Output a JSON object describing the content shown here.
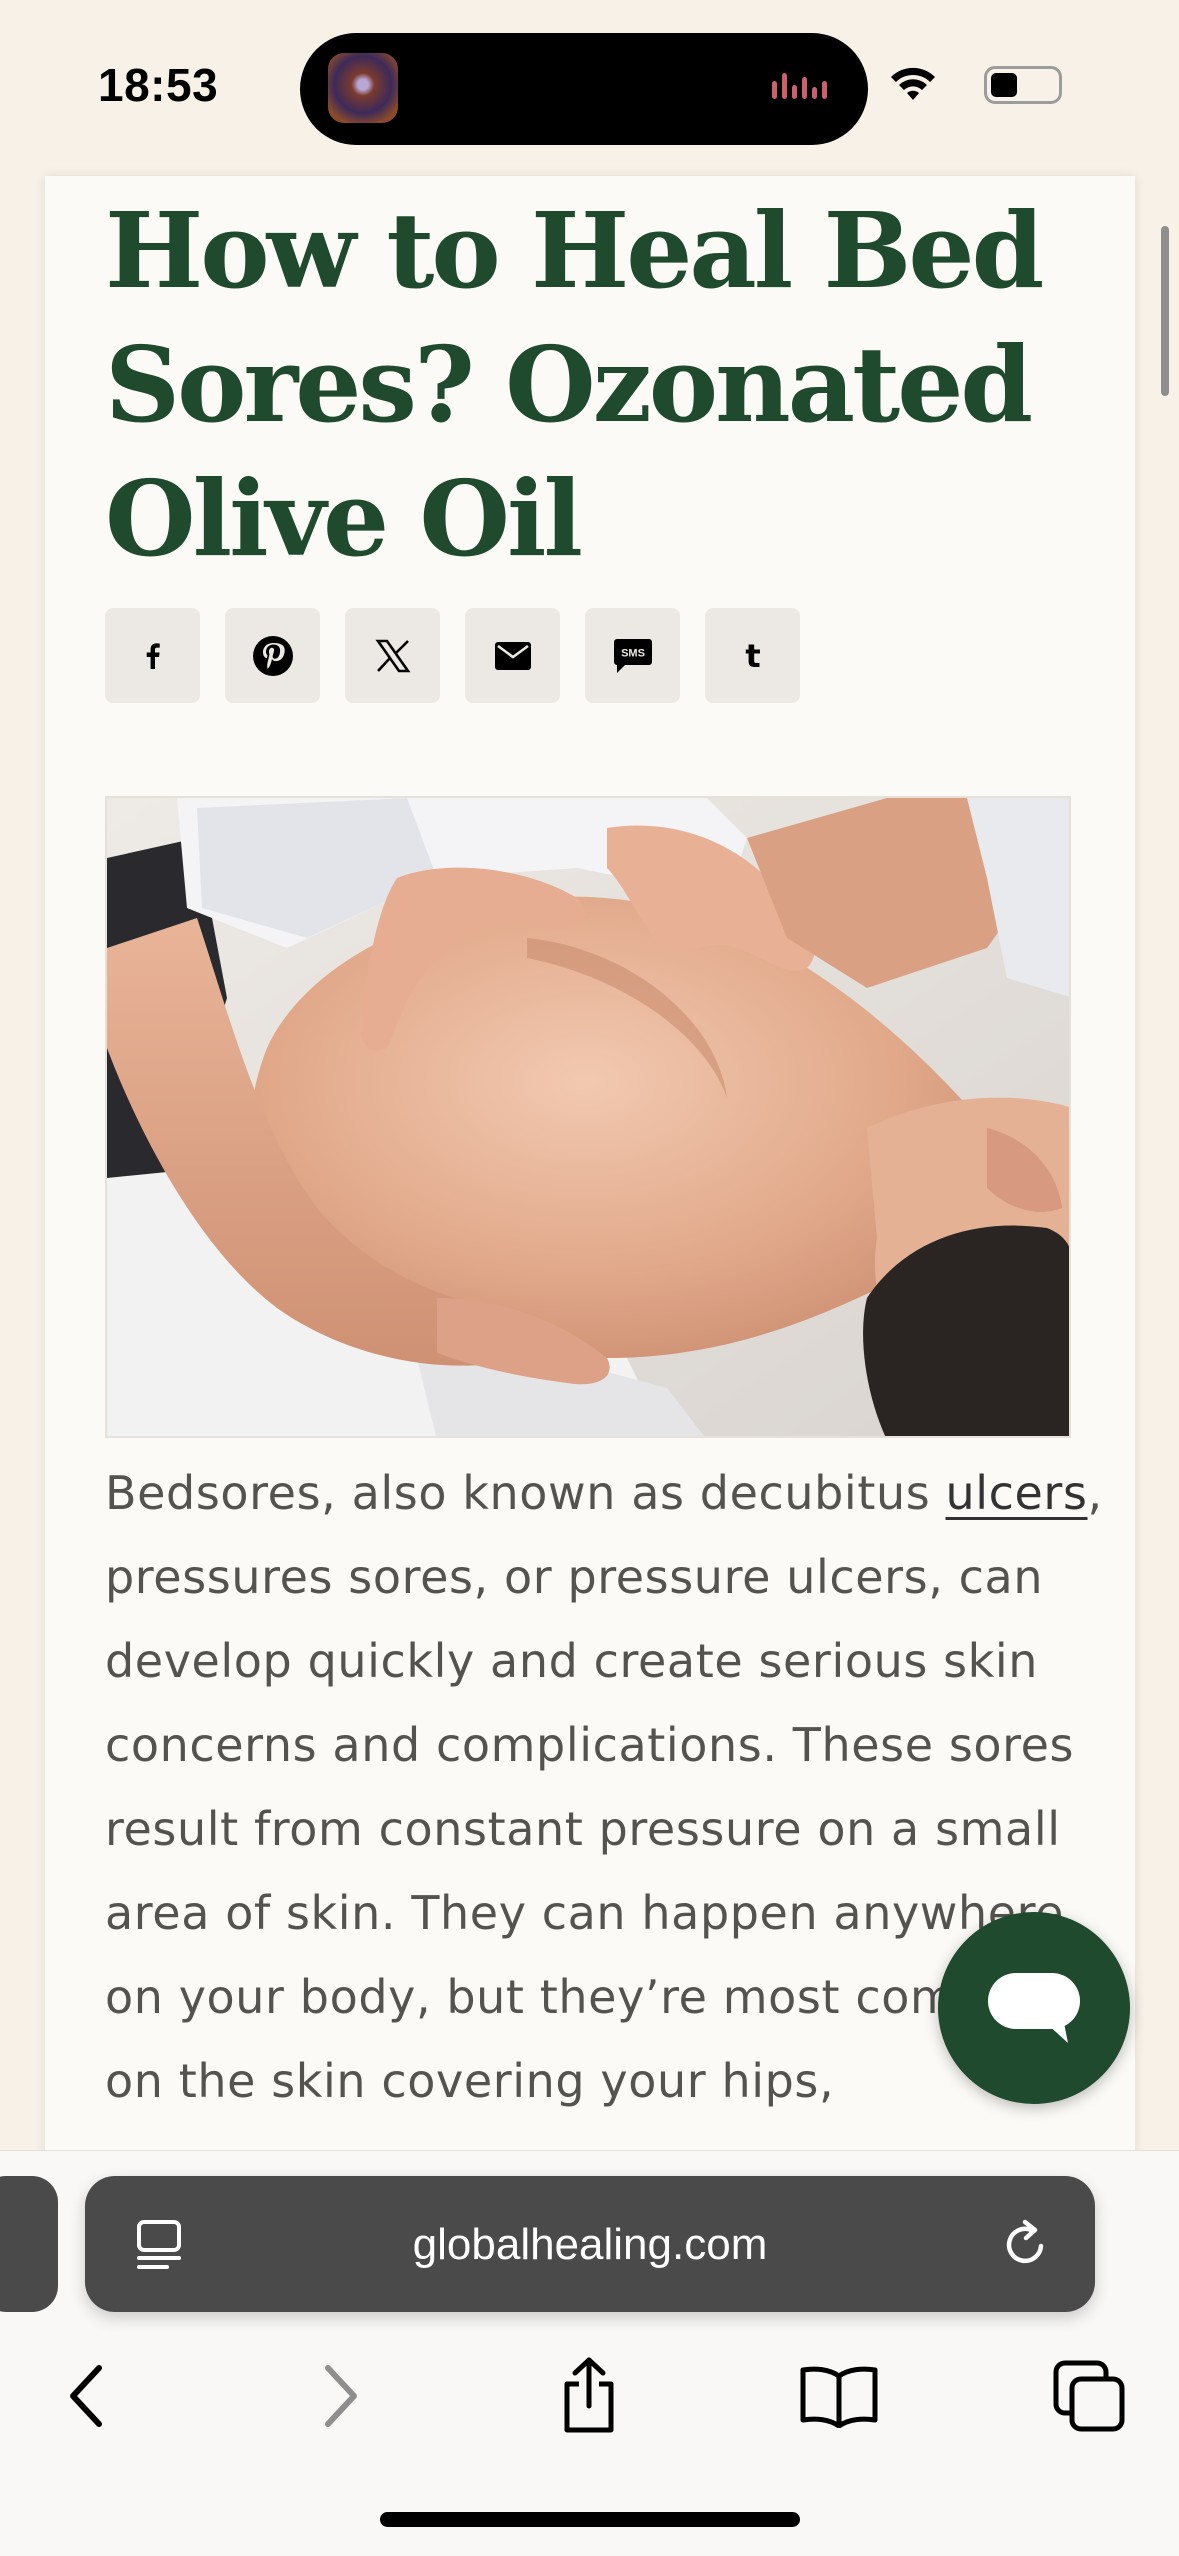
{
  "status_bar": {
    "time": "18:53"
  },
  "article": {
    "title": "How to Heal Bed Sores? Ozonated Olive Oil",
    "share_buttons": [
      {
        "icon": "facebook-icon",
        "glyph": "f"
      },
      {
        "icon": "pinterest-icon",
        "glyph": "P"
      },
      {
        "icon": "x-icon",
        "glyph": "X"
      },
      {
        "icon": "email-icon",
        "glyph": "mail"
      },
      {
        "icon": "sms-icon",
        "glyph": "SMS"
      },
      {
        "icon": "tumblr-icon",
        "glyph": "t"
      }
    ],
    "image_alt": "Therapist massaging a man's back",
    "body_prefix": "Bedsores, also known as decubitus ",
    "body_link": "ulcers",
    "body_rest": ", pressures sores, or pressure ulcers, can develop quickly and create serious skin concerns and complications. These sores result from constant pressure on a small area of skin. They can happen anywhere on your body, but they’re most common on the skin covering your hips,"
  },
  "browser": {
    "url": "globalhealing.com"
  },
  "colors": {
    "brand_green": "#1f4a2e",
    "page_bg": "#f7f1e8",
    "url_bar_bg": "#4a4a4a"
  }
}
